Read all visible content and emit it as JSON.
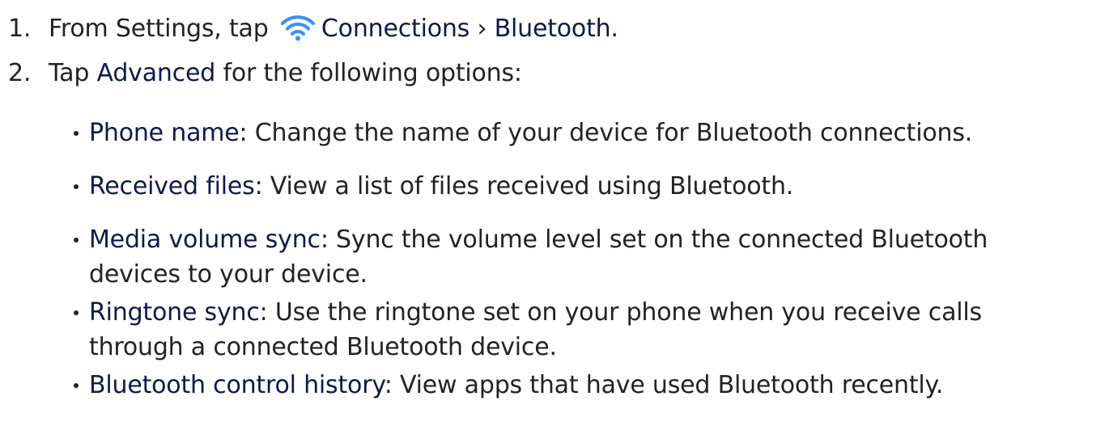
{
  "step1": {
    "number": "1.",
    "text_before": "From Settings, tap",
    "icon": "wifi-icon",
    "connections": "Connections",
    "separator": "›",
    "bluetooth": "Bluetooth",
    "end": "."
  },
  "step2": {
    "number": "2.",
    "text_before": "Tap",
    "advanced": "Advanced",
    "text_after": "for the following options:"
  },
  "options": [
    {
      "term": "Phone name",
      "desc_line1": ": Change the name of your device for Bluetooth connections.",
      "desc_line2": ""
    },
    {
      "term": "Received files",
      "desc_line1": ": View a list of files received using Bluetooth.",
      "desc_line2": ""
    },
    {
      "term": "Media volume sync",
      "desc_line1": ": Sync the volume level set on the connected Bluetooth",
      "desc_line2": "devices to your device."
    },
    {
      "term": "Ringtone sync",
      "desc_line1": ": Use the ringtone set on your phone when you receive calls",
      "desc_line2": "through a connected Bluetooth device."
    },
    {
      "term": "Bluetooth control history",
      "desc_line1": ": View apps that have used Bluetooth recently.",
      "desc_line2": ""
    }
  ],
  "colors": {
    "text": "#222222",
    "emphasis": "#0b1a4a",
    "icon": "#3d8ff5"
  }
}
